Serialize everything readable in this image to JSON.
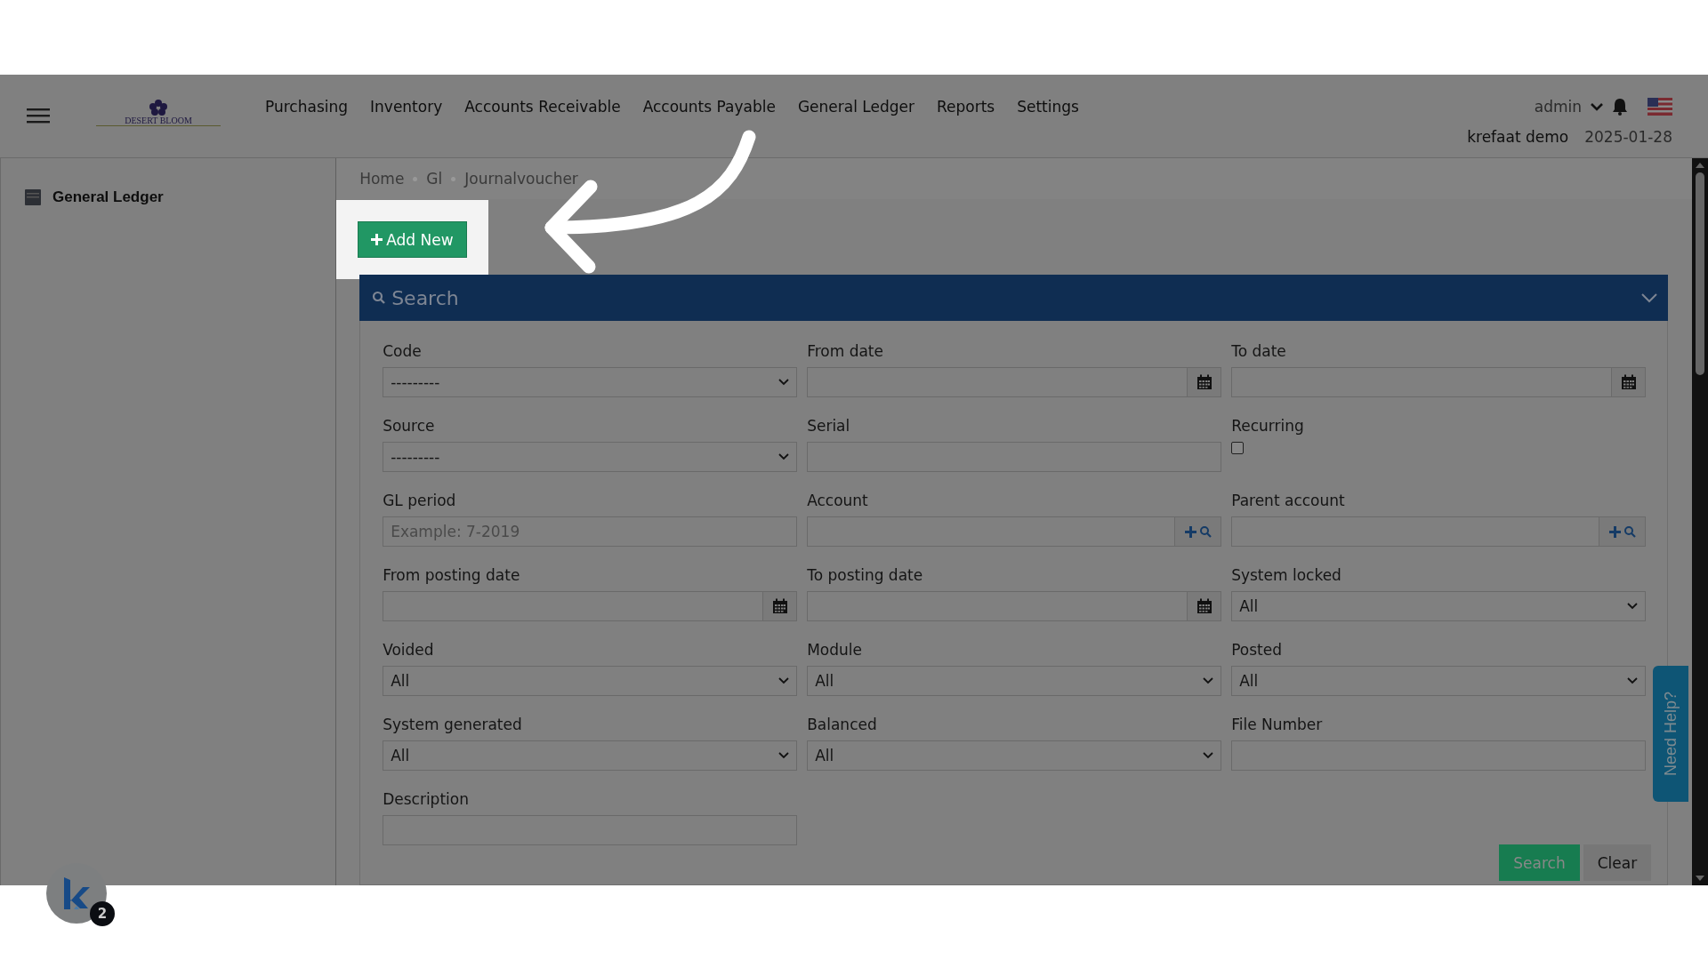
{
  "header": {
    "logo_text": "DESERT BLOOM",
    "nav": [
      "Purchasing",
      "Inventory",
      "Accounts Receivable",
      "Accounts Payable",
      "General Ledger",
      "Reports",
      "Settings"
    ],
    "user": "admin",
    "company": "krefaat demo",
    "date": "2025-01-28"
  },
  "sidebar": {
    "items": [
      {
        "label": "General Ledger"
      }
    ]
  },
  "breadcrumb": [
    "Home",
    "Gl",
    "Journalvoucher"
  ],
  "add_button": "Add New",
  "search_panel": {
    "title": "Search",
    "fields": [
      {
        "label": "Code",
        "kind": "select",
        "value": "---------"
      },
      {
        "label": "From date",
        "kind": "date"
      },
      {
        "label": "To date",
        "kind": "date"
      },
      {
        "label": "Source",
        "kind": "select",
        "value": "---------"
      },
      {
        "label": "Serial",
        "kind": "text"
      },
      {
        "label": "Recurring",
        "kind": "checkbox",
        "checked": false
      },
      {
        "label": "GL period",
        "kind": "text",
        "placeholder": "Example: 7-2019"
      },
      {
        "label": "Account",
        "kind": "lookup"
      },
      {
        "label": "Parent account",
        "kind": "lookup"
      },
      {
        "label": "From posting date",
        "kind": "date"
      },
      {
        "label": "To posting date",
        "kind": "date"
      },
      {
        "label": "System locked",
        "kind": "select",
        "value": "All"
      },
      {
        "label": "Voided",
        "kind": "select",
        "value": "All"
      },
      {
        "label": "Module",
        "kind": "select",
        "value": "All"
      },
      {
        "label": "Posted",
        "kind": "select",
        "value": "All"
      },
      {
        "label": "System generated",
        "kind": "select",
        "value": "All"
      },
      {
        "label": "Balanced",
        "kind": "select",
        "value": "All"
      },
      {
        "label": "File Number",
        "kind": "text"
      },
      {
        "label": "Description",
        "kind": "text"
      }
    ],
    "buttons": [
      "Search",
      "Clear"
    ]
  },
  "help_tab": "Need Help?",
  "assistant_badge": "2"
}
